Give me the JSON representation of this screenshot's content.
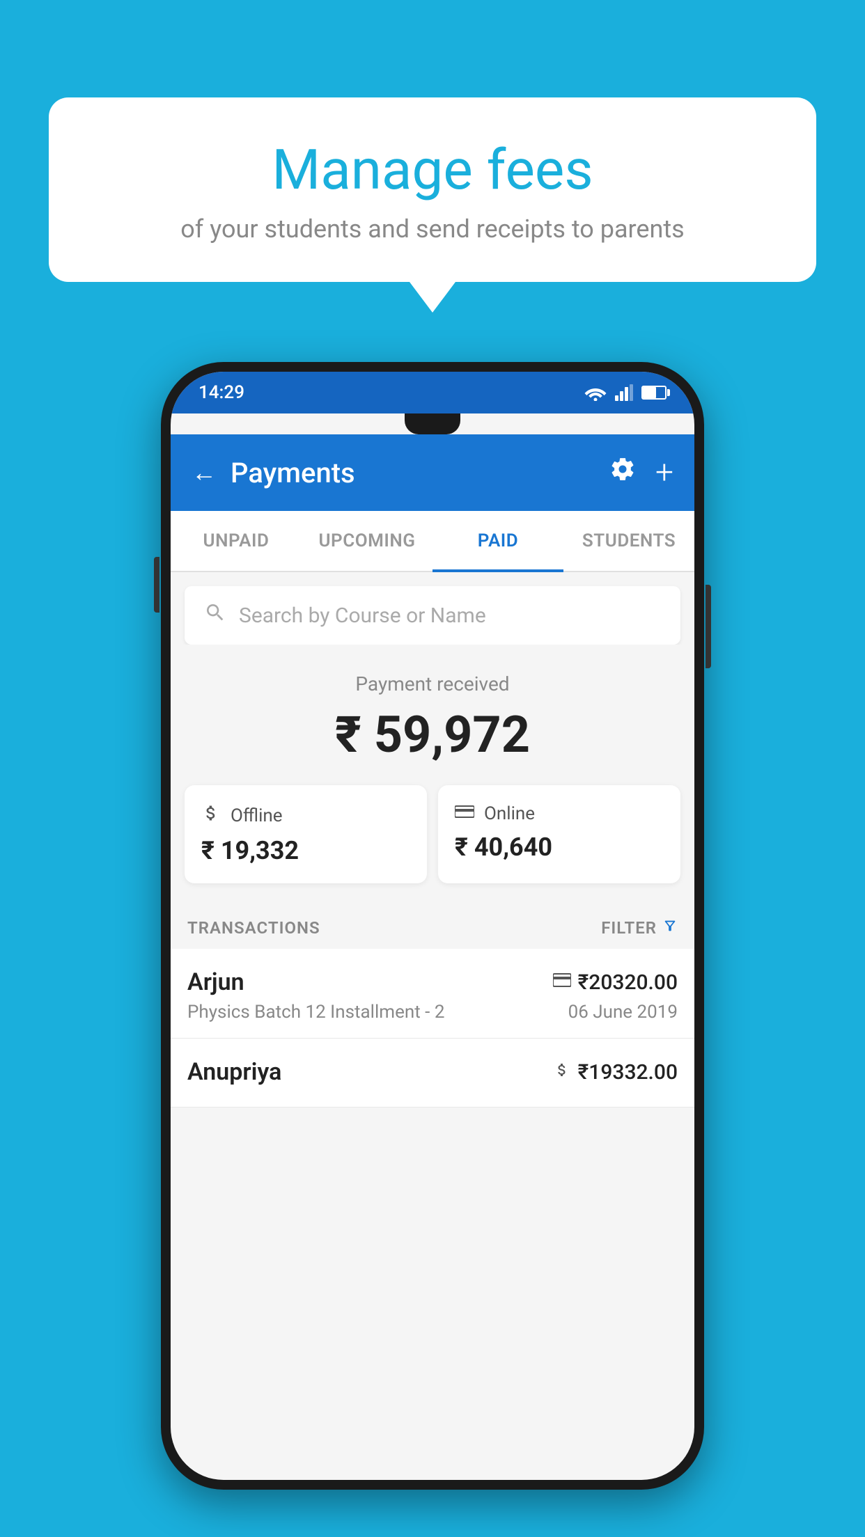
{
  "page": {
    "background_color": "#1AAFDC"
  },
  "speech_bubble": {
    "title": "Manage fees",
    "subtitle": "of your students and send receipts to parents"
  },
  "status_bar": {
    "time": "14:29"
  },
  "app_bar": {
    "title": "Payments",
    "back_label": "←",
    "gear_label": "⚙",
    "plus_label": "+"
  },
  "tabs": [
    {
      "label": "UNPAID",
      "active": false
    },
    {
      "label": "UPCOMING",
      "active": false
    },
    {
      "label": "PAID",
      "active": true
    },
    {
      "label": "STUDENTS",
      "active": false
    }
  ],
  "search": {
    "placeholder": "Search by Course or Name"
  },
  "payment_summary": {
    "label": "Payment received",
    "amount": "₹ 59,972"
  },
  "payment_cards": [
    {
      "icon": "💳",
      "type": "Offline",
      "amount": "₹ 19,332"
    },
    {
      "icon": "💳",
      "type": "Online",
      "amount": "₹ 40,640"
    }
  ],
  "transactions_section": {
    "label": "TRANSACTIONS",
    "filter_label": "FILTER"
  },
  "transactions": [
    {
      "name": "Arjun",
      "icon": "💳",
      "amount": "₹20320.00",
      "course": "Physics Batch 12 Installment - 2",
      "date": "06 June 2019"
    },
    {
      "name": "Anupriya",
      "icon": "💵",
      "amount": "₹19332.00",
      "course": "",
      "date": ""
    }
  ]
}
